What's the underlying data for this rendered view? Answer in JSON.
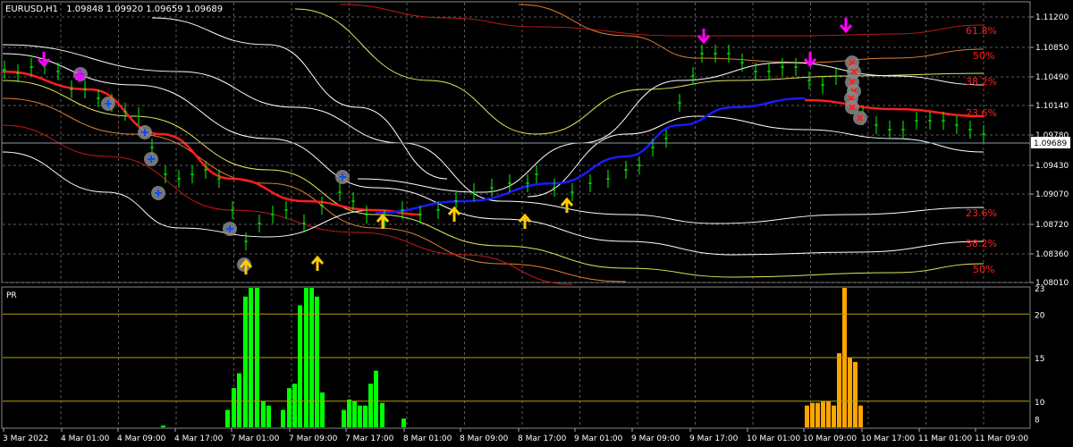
{
  "window": {
    "title": "EURUSD,H1",
    "ohlc": "1.09848 1.09920 1.09659 1.09689"
  },
  "main_panel": {
    "price_axis_labels": [
      "1.11200",
      "1.10850",
      "1.10490",
      "1.10140",
      "1.09780",
      "1.09430",
      "1.09070",
      "1.08720",
      "1.08360",
      "1.08010"
    ],
    "current_price": "1.09689",
    "fib_labels_upper": [
      "61.8%",
      "50%",
      "38.2%",
      "23.6%"
    ],
    "fib_labels_lower": [
      "23.6%",
      "38.2%",
      "50%"
    ]
  },
  "sub_panel": {
    "title": "PR",
    "axis_labels": [
      "23",
      "20",
      "15",
      "10",
      "8"
    ],
    "levels": [
      20,
      15,
      10
    ]
  },
  "time_axis": {
    "labels": [
      "3 Mar 2022",
      "4 Mar 01:00",
      "4 Mar 09:00",
      "4 Mar 17:00",
      "7 Mar 01:00",
      "7 Mar 09:00",
      "7 Mar 17:00",
      "8 Mar 01:00",
      "8 Mar 09:00",
      "8 Mar 17:00",
      "9 Mar 01:00",
      "9 Mar 09:00",
      "9 Mar 17:00",
      "10 Mar 01:00",
      "10 Mar 09:00",
      "10 Mar 17:00",
      "11 Mar 01:00",
      "11 Mar 09:00"
    ]
  },
  "colors": {
    "background": "#000000",
    "grid": "#5a5a5a",
    "candle": "#00ff00",
    "ma_red": "#ff1e1e",
    "ma_blue": "#1a1aff",
    "band_white": "#ffffff",
    "band_yellow": "#e6e65a",
    "band_orange": "#e08030",
    "band_darkred": "#c01818",
    "sell_arrow": "#ff00ff",
    "buy_arrow": "#ffcc00",
    "fib_text": "#ff2020",
    "hist_green": "#00ff00",
    "hist_orange": "#ffa500",
    "level_line": "#b8a000"
  },
  "chart_data": {
    "type": "bar",
    "title": "PR",
    "x": [
      "3 Mar 2022",
      "4 Mar 01:00",
      "4 Mar 09:00",
      "4 Mar 17:00",
      "7 Mar 01:00",
      "7 Mar 09:00",
      "7 Mar 17:00",
      "8 Mar 01:00",
      "8 Mar 09:00",
      "8 Mar 17:00",
      "9 Mar 01:00",
      "9 Mar 09:00",
      "9 Mar 17:00",
      "10 Mar 01:00",
      "10 Mar 09:00",
      "10 Mar 17:00",
      "11 Mar 01:00",
      "11 Mar 09:00"
    ],
    "ylim": [
      7,
      23
    ],
    "levels": [
      10,
      15,
      20
    ],
    "series": [
      {
        "color": "#00ff00",
        "values": [
          [
            183,
            7.2
          ],
          [
            255,
            9.0
          ],
          [
            262,
            11.5
          ],
          [
            268,
            13.2
          ],
          [
            275,
            22.0
          ],
          [
            281,
            23
          ],
          [
            288,
            23
          ],
          [
            295,
            10.0
          ],
          [
            301,
            9.5
          ],
          [
            317,
            9.0
          ],
          [
            324,
            11.5
          ],
          [
            330,
            12.0
          ],
          [
            336,
            21.0
          ],
          [
            343,
            23
          ],
          [
            349,
            23
          ],
          [
            355,
            22.0
          ],
          [
            361,
            11.0
          ],
          [
            385,
            9.0
          ],
          [
            391,
            10.2
          ],
          [
            397,
            10.0
          ],
          [
            403,
            9.5
          ],
          [
            409,
            9.5
          ],
          [
            415,
            12.0
          ],
          [
            421,
            13.5
          ],
          [
            428,
            9.8
          ],
          [
            452,
            8.0
          ]
        ]
      },
      {
        "color": "#ffa500",
        "values": [
          [
            903,
            9.5
          ],
          [
            909,
            9.8
          ],
          [
            915,
            9.8
          ],
          [
            921,
            10.0
          ],
          [
            927,
            10.0
          ],
          [
            933,
            9.5
          ],
          [
            939,
            15.5
          ],
          [
            945,
            23
          ],
          [
            951,
            15.0
          ],
          [
            957,
            14.5
          ],
          [
            963,
            9.5
          ]
        ]
      }
    ]
  }
}
